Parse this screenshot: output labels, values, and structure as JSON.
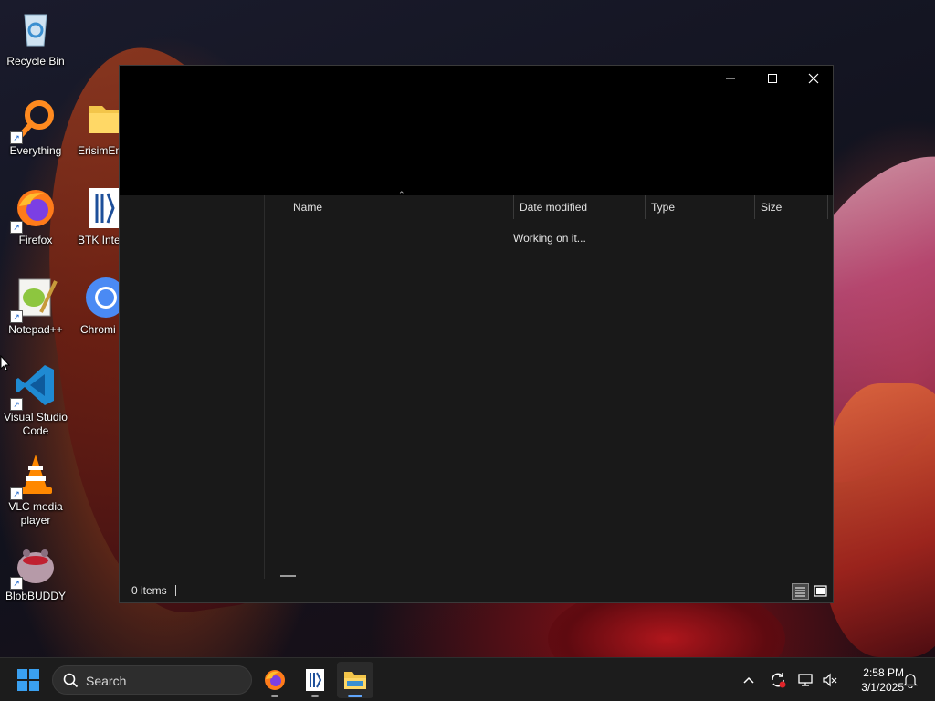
{
  "desktop": {
    "icons": [
      {
        "label": "Recycle Bin"
      },
      {
        "label": "Everything"
      },
      {
        "label": "ErisimEn"
      },
      {
        "label": "Firefox"
      },
      {
        "label": "BTK Inter Agi"
      },
      {
        "label": "Notepad++"
      },
      {
        "label": "Chromi"
      },
      {
        "label": "Visual Studio Code"
      },
      {
        "label": "VLC media player"
      },
      {
        "label": "BlobBUDDY"
      }
    ]
  },
  "explorer": {
    "columns": [
      "Name",
      "Date modified",
      "Type",
      "Size"
    ],
    "loading_text": "Working on it...",
    "status_count": "0 items"
  },
  "taskbar": {
    "search_label": "Search",
    "time": "2:58 PM",
    "date": "3/1/2025",
    "apps": [
      "firefox",
      "btk-akademi",
      "file-explorer"
    ]
  },
  "colors": {
    "window_bg": "#191919",
    "titlebar_bg": "#000000",
    "taskbar_bg": "#1c1c1c",
    "accent": "#0078d4"
  }
}
